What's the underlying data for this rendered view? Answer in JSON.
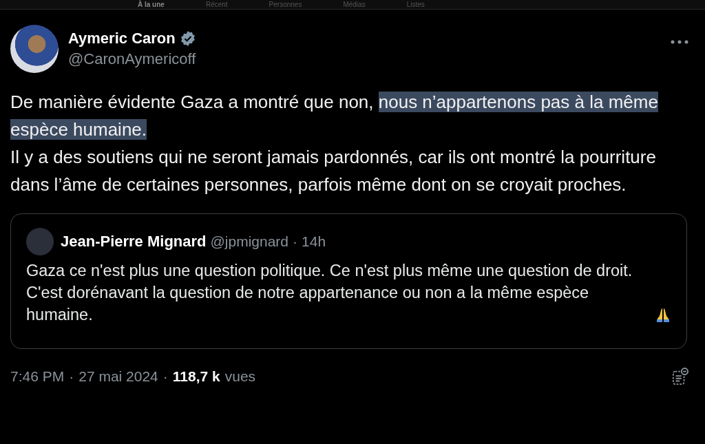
{
  "top_tabs": [
    {
      "label": "À la une",
      "selected": true
    },
    {
      "label": "Récent",
      "selected": false
    },
    {
      "label": "Personnes",
      "selected": false
    },
    {
      "label": "Médias",
      "selected": false
    },
    {
      "label": "Listes",
      "selected": false
    }
  ],
  "author": {
    "name": "Aymeric Caron",
    "handle": "@CaronAymericoff",
    "verified": true
  },
  "body": {
    "paragraphs": [
      [
        {
          "text": "De manière évidente Gaza a montré que non, ",
          "highlighted": false
        },
        {
          "text": "nous n’appartenons pas à la même espèce humaine.",
          "highlighted": true
        }
      ],
      [
        {
          "text": "Il y a des soutiens qui ne seront jamais pardonnés, car ils ont montré la pourriture dans l’âme de certaines personnes, parfois même dont on se croyait proches.",
          "highlighted": false
        }
      ]
    ]
  },
  "quote": {
    "name": "Jean-Pierre Mignard",
    "handle": "@jpmignard",
    "separator": "·",
    "time": "14h",
    "text": "Gaza ce n'est plus une question politique. Ce n'est plus même une question de droit.  C'est dorénavant la question de notre appartenance ou non a la même espèce humaine."
  },
  "footer": {
    "time": "7:46 PM",
    "separator_1": "·",
    "date": "27 mai 2024",
    "separator_2": "·",
    "views_count": "118,7 k",
    "views_label": "vues"
  }
}
